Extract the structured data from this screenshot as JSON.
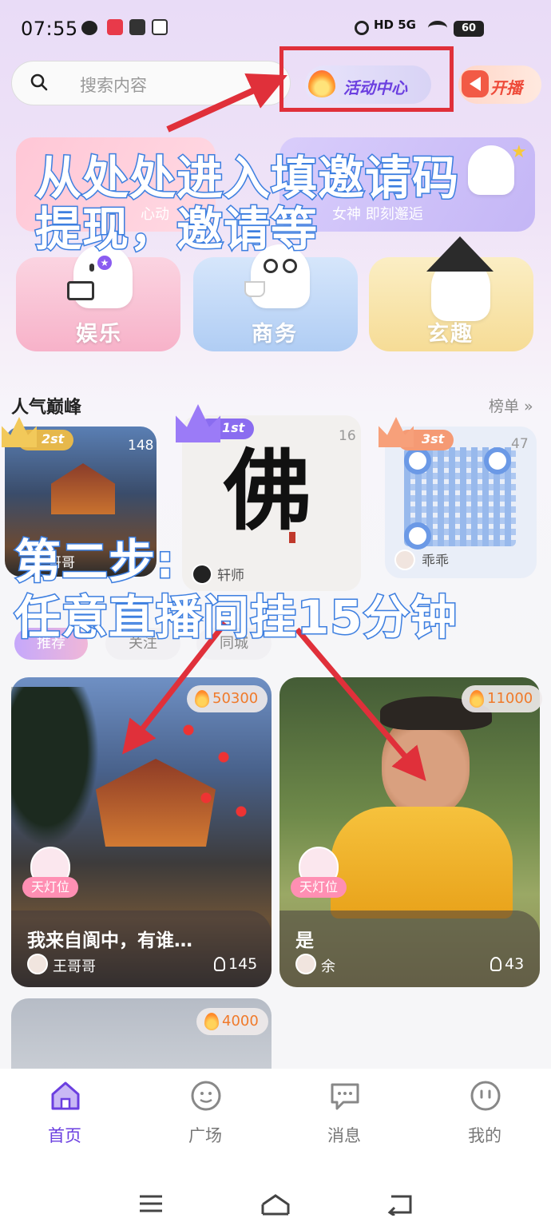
{
  "status_bar": {
    "time": "07:55",
    "network": "HD 5G",
    "battery": "60"
  },
  "search": {
    "placeholder": "搜索内容"
  },
  "header": {
    "activity_center_label": "活动中心",
    "go_live_label": "开播"
  },
  "banners": [
    {
      "subtitle": "心动"
    },
    {
      "subtitle": "女神 即刻邂逅"
    }
  ],
  "categories": [
    {
      "label": "娱乐",
      "color": "#f7b8cc"
    },
    {
      "label": "商务",
      "color": "#b9d4f7"
    },
    {
      "label": "玄趣",
      "color": "#f7e2a8"
    }
  ],
  "popular": {
    "title": "人气巅峰",
    "rank_link": "榜单 »",
    "cards": [
      {
        "rank": "2st",
        "count": "148",
        "host": "哥哥",
        "badge_color": "#e6b84b"
      },
      {
        "rank": "1st",
        "count": "16",
        "host": "轩师",
        "badge_color": "#8a6cf0"
      },
      {
        "rank": "3st",
        "count": "47",
        "host": "乖乖",
        "badge_color": "#f59a74"
      }
    ]
  },
  "feed_tabs": [
    "推荐",
    "关注",
    "同城"
  ],
  "feed": [
    {
      "hot": "50300",
      "badge": "天灯位",
      "title": "我来自阆中，有谁…",
      "host": "王哥哥",
      "viewers": "145"
    },
    {
      "hot": "11000",
      "badge": "天灯位",
      "title": "是",
      "host": "余",
      "viewers": "43"
    },
    {
      "hot": "4000"
    }
  ],
  "annotations": {
    "line1": "从处处进入填邀请码",
    "line2": "提现，邀请等",
    "line3": "第二步:",
    "line4": "任意直播间挂15分钟"
  },
  "bottom_nav": [
    {
      "label": "首页",
      "active": true
    },
    {
      "label": "广场",
      "active": false
    },
    {
      "label": "消息",
      "active": false
    },
    {
      "label": "我的",
      "active": false
    }
  ],
  "colors": {
    "accent": "#7a4fe0",
    "annotation_arrow": "#e0303a",
    "annotation_text_stroke": "#3d7fe0"
  }
}
